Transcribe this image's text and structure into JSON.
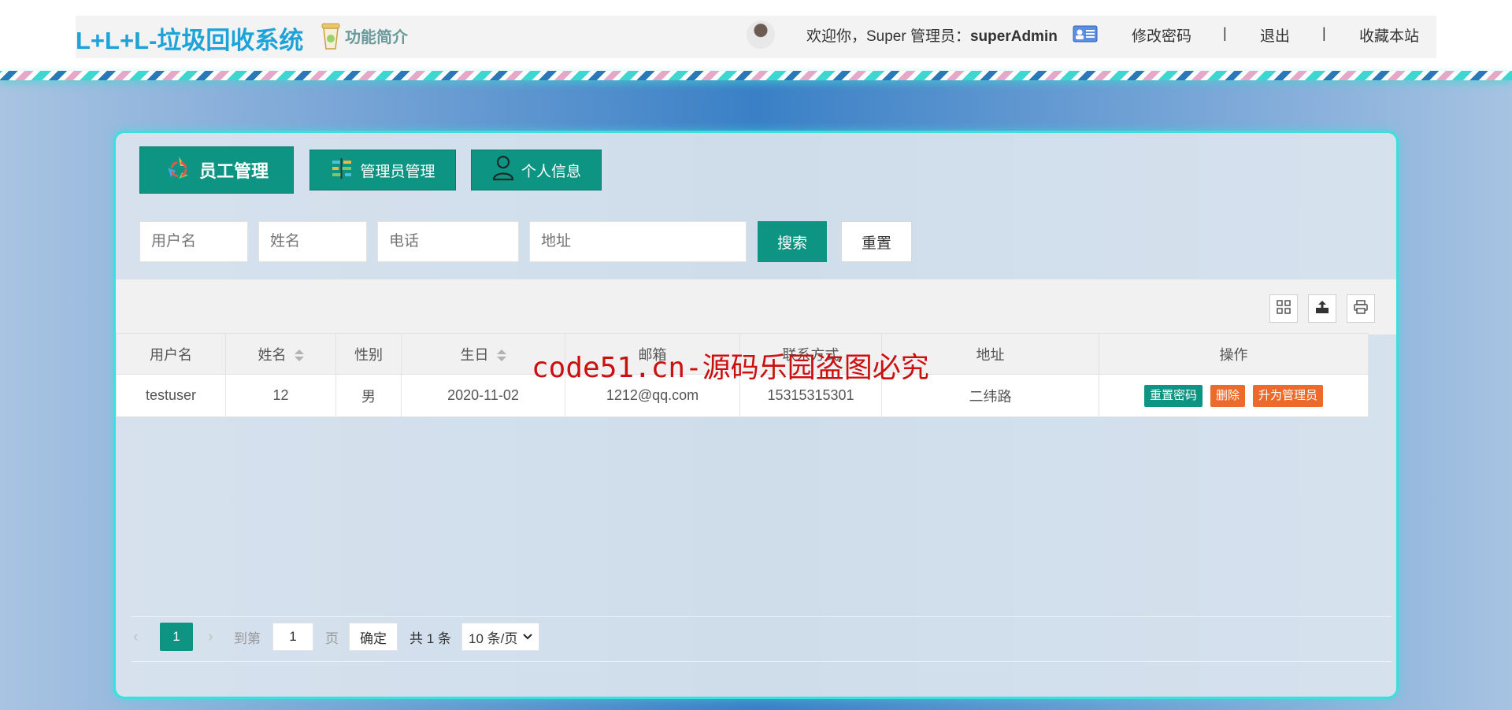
{
  "header": {
    "logo": "L+L+L-垃圾回收系统",
    "intro_label": "功能简介",
    "welcome_prefix": "欢迎你，Super 管理员：",
    "username": "superAdmin",
    "change_password": "修改密码",
    "sep1": "|",
    "logout": "退出",
    "sep2": "|",
    "bookmark": "收藏本站"
  },
  "tabs": [
    {
      "label": "员工管理",
      "icon": "recycle-icon"
    },
    {
      "label": "管理员管理",
      "icon": "sliders-icon"
    },
    {
      "label": "个人信息",
      "icon": "user-icon"
    }
  ],
  "search": {
    "username_placeholder": "用户名",
    "name_placeholder": "姓名",
    "phone_placeholder": "电话",
    "address_placeholder": "地址",
    "search_label": "搜索",
    "reset_label": "重置"
  },
  "toolbar": {
    "icons": [
      "columns-icon",
      "export-icon",
      "print-icon"
    ]
  },
  "table": {
    "columns": [
      "用户名",
      "姓名",
      "性别",
      "生日",
      "邮箱",
      "联系方式",
      "地址",
      "操作"
    ],
    "rows": [
      {
        "username": "testuser",
        "name": "12",
        "gender": "男",
        "birthday": "2020-11-02",
        "email": "1212@qq.com",
        "phone": "15315315301",
        "address": "二纬路",
        "actions": [
          "重置密码",
          "删除",
          "升为管理员"
        ]
      }
    ]
  },
  "watermark": "code51.cn-源码乐园盗图必究",
  "pagination": {
    "current_page": "1",
    "goto_label": "到第",
    "goto_value": "1",
    "page_label": "页",
    "confirm_label": "确定",
    "total_label": "共 1 条",
    "page_size": "10 条/页"
  },
  "colors": {
    "primary": "#0e9482",
    "danger": "#ee6a2a",
    "logo": "#1ea3d8",
    "panel_border": "#3be0de"
  }
}
